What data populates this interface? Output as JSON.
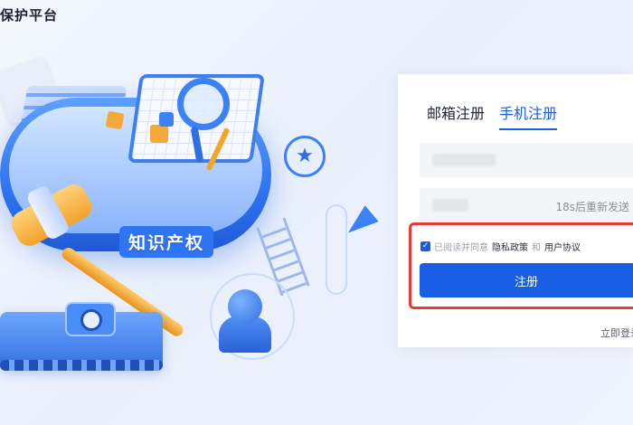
{
  "header": {
    "title": "保护平台"
  },
  "illustration": {
    "label": "知识产权",
    "icons": [
      "gavel-icon",
      "magnifier-icon",
      "star-icon",
      "paper-plane-icon",
      "eye-icon",
      "puzzle-icon",
      "ladder-icon",
      "person-icon"
    ]
  },
  "form": {
    "tabs": [
      {
        "label": "邮箱注册",
        "active": false
      },
      {
        "label": "手机注册",
        "active": true
      }
    ],
    "phone_field": {
      "value": ""
    },
    "code_field": {
      "value": "",
      "resend_label": "18s后重新发送"
    },
    "agreement": {
      "checked": true,
      "prefix": "已阅读并同意",
      "privacy": "隐私政策",
      "and": "和",
      "terms": "用户协议"
    },
    "register_button": "注册",
    "login_link": "立即登录"
  },
  "colors": {
    "primary": "#1a5ee6",
    "highlight": "#e53935",
    "background": "#eef3fc"
  }
}
